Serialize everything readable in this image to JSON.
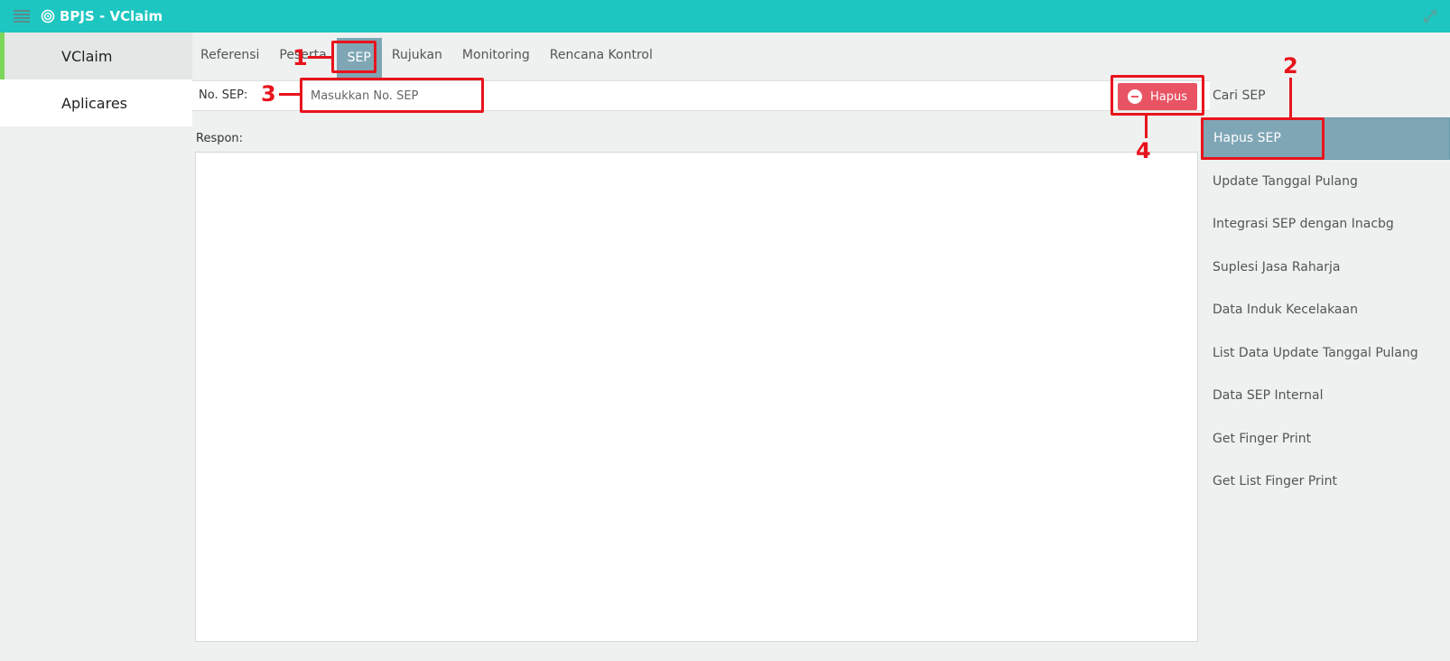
{
  "app": {
    "title": "BPJS - VClaim"
  },
  "topbar": {
    "menu_icon": "hamburger-icon",
    "app_icon": "gear-icon",
    "expand_icon": "expand-arrows-icon"
  },
  "leftnav": {
    "items": [
      {
        "label": "VClaim"
      },
      {
        "label": "Aplicares"
      }
    ]
  },
  "tabs": [
    {
      "label": "Referensi"
    },
    {
      "label": "Peserta"
    },
    {
      "label": "SEP"
    },
    {
      "label": "Rujukan"
    },
    {
      "label": "Monitoring"
    },
    {
      "label": "Rencana Kontrol"
    }
  ],
  "form": {
    "no_sep_label": "No. SEP:",
    "no_sep_value": "",
    "no_sep_placeholder": "Masukkan No. SEP",
    "hapus_label": "Hapus",
    "respon_label": "Respon:"
  },
  "rightmenu": {
    "items": [
      {
        "label": "Cari SEP"
      },
      {
        "label": "Hapus SEP"
      },
      {
        "label": "Update Tanggal Pulang"
      },
      {
        "label": "Integrasi SEP dengan Inacbg"
      },
      {
        "label": "Suplesi Jasa Raharja"
      },
      {
        "label": "Data Induk Kecelakaan"
      },
      {
        "label": "List Data Update Tanggal Pulang"
      },
      {
        "label": "Data SEP Internal"
      },
      {
        "label": "Get Finger Print"
      },
      {
        "label": "Get List Finger Print"
      }
    ]
  },
  "annotations": {
    "n1": "1",
    "n2": "2",
    "n3": "3",
    "n4": "4"
  },
  "colors": {
    "topbar": "#1dc6c1",
    "active_tab": "#7fa6b5",
    "danger": "#e85464",
    "annotation": "#e8141c",
    "nav_accent": "#7cd65a"
  }
}
